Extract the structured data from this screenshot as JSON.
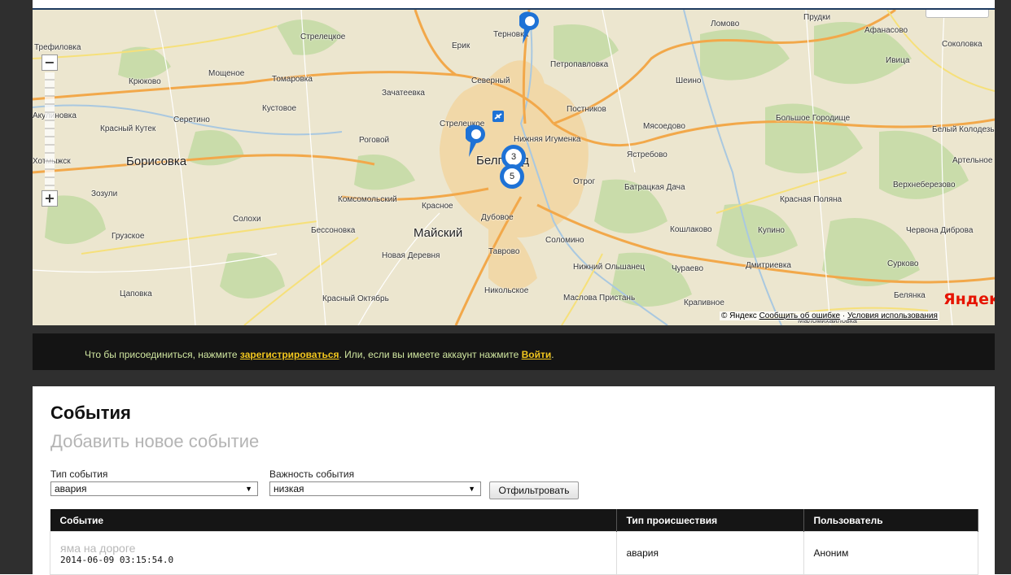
{
  "map": {
    "logo_text": "Яндекс",
    "copyright": "© Яндекс",
    "report_error_link": "Сообщить об ошибке",
    "terms_link": "Условия использования",
    "zoom_minus": "−",
    "zoom_plus": "+",
    "clusters": [
      "3",
      "5"
    ],
    "places": {
      "prudki": "Прудки",
      "lomovo": "Ломово",
      "afanasovo": "Афанасово",
      "sokolovka": "Соколовка",
      "ivica": "Ивица",
      "trefilovka": "Трефиловка",
      "streletskoe": "Стрелецкое",
      "erik": "Ерик",
      "ternovka": "Терновка",
      "petropavlovka": "Петропавловка",
      "moshchenoe": "Мощеное",
      "kryukovo": "Крюково",
      "tomarovka": "Томаровка",
      "severny": "Северный",
      "sheino": "Шеино",
      "zachateevka": "Зачатеевка",
      "kustovoe": "Кустовое",
      "akulinovka": "Акулиновка",
      "seretino": "Серетино",
      "postnikov": "Постников",
      "bolshoe_gorodishche": "Большое Городище",
      "krasny_kutok": "Красный Кутек",
      "streletskoe2": "Стрелецкое",
      "nizhnyaya_igumenka": "Нижняя Игуменка",
      "miasoedovo": "Мясоедово",
      "bely_kolodez": "Белый Колодезь",
      "rogovoi": "Роговой",
      "yastrebovo": "Ястребово",
      "khotmyzhsk": "Хотмыжск",
      "borisovka": "Борисовка",
      "belgorod": "Белгород",
      "artelnoe": "Артельное",
      "otrog": "Отрог",
      "batratskaya_dacha": "Батрацкая Дача",
      "verkhneberezovo": "Верхнеберезово",
      "zozuli": "Зозули",
      "komsomolsky": "Комсомольский",
      "krasnaya_polyana": "Красная Поляна",
      "krasnoe": "Красное",
      "dubovoe": "Дубовое",
      "solohi": "Солохи",
      "bessonovka": "Бессоновка",
      "kashlakovo": "Кошлаково",
      "kupino": "Купино",
      "chervona_dibrovka": "Червона Диброва",
      "gruzskoe": "Грузское",
      "maisky": "Майский",
      "solomino": "Соломино",
      "tavrovo": "Таврово",
      "novaya_derevnya": "Новая Деревня",
      "dmitrievka": "Дмитриевка",
      "surkovo": "Сурково",
      "nizhny_olshanets": "Нижний Ольшанец",
      "churaevo": "Чураево",
      "tsapovka": "Цаповка",
      "nikolskoe": "Никольское",
      "belyanka": "Белянка",
      "krasny_oktyabr": "Красный Октябрь",
      "maslova_pristan": "Маслова Пристань",
      "krapivnoe": "Крапивное",
      "malomikhailovka": "Маломихайловка"
    }
  },
  "join_bar": {
    "prefix": "Что бы присоединиться, нажмите ",
    "register_link": "зарегистрироваться",
    "middle": ". Или, если вы имеете аккаунт нажмите ",
    "login_link": "Войти",
    "suffix": "."
  },
  "content": {
    "title": "События",
    "add_event": "Добавить новое событие",
    "filters": {
      "type_label": "Тип события",
      "type_value": "авария",
      "importance_label": "Важность события",
      "importance_value": "низкая",
      "button": "Отфильтровать"
    },
    "table": {
      "headers": [
        "Событие",
        "Тип происшествия",
        "Пользователь"
      ],
      "rows": [
        {
          "title": "яма на дороге",
          "time": "2014-06-09 03:15:54.0",
          "type": "авария",
          "user": "Аноним"
        }
      ]
    }
  },
  "colors": {
    "frame": "#2f2f2f",
    "join_bar_bg": "#141414",
    "link_yellow": "#f3c71e",
    "cluster_blue": "#1e72d6",
    "yandex_red": "#e61400"
  },
  "icons": [
    "map-pin-icon",
    "airport-icon",
    "chevron-down-icon"
  ]
}
